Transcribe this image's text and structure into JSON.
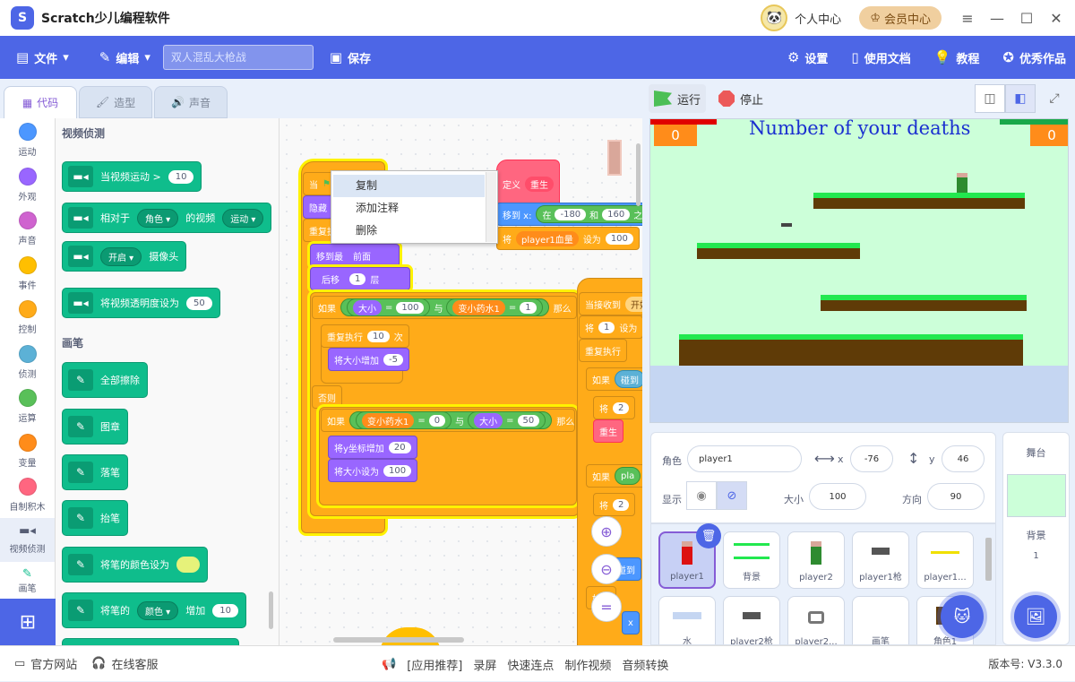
{
  "titlebar": {
    "app_title": "Scratch少儿编程软件",
    "personal_center": "个人中心",
    "vip_label": "会员中心",
    "window_controls": [
      "≡",
      "—",
      "☐",
      "✕"
    ]
  },
  "menubar": {
    "file": "文件",
    "edit": "编辑",
    "project_placeholder": "双人混乱大枪战",
    "save": "保存",
    "settings": "设置",
    "docs": "使用文档",
    "tutorial": "教程",
    "showcase": "优秀作品"
  },
  "tabs": {
    "code": "代码",
    "costume": "造型",
    "sound": "声音"
  },
  "categories": [
    {
      "label": "运动",
      "color": "#4c97ff"
    },
    {
      "label": "外观",
      "color": "#9966ff"
    },
    {
      "label": "声音",
      "color": "#cf63cf"
    },
    {
      "label": "事件",
      "color": "#ffbf00"
    },
    {
      "label": "控制",
      "color": "#ffab19"
    },
    {
      "label": "侦测",
      "color": "#5cb1d6"
    },
    {
      "label": "运算",
      "color": "#59c059"
    },
    {
      "label": "变量",
      "color": "#ff8c1a"
    },
    {
      "label": "自制积木",
      "color": "#ff6680"
    },
    {
      "label": "视频侦测",
      "color": "#0fbd8c"
    },
    {
      "label": "画笔",
      "color": "#0fbd8c"
    }
  ],
  "palette": {
    "video_title": "视频侦测",
    "video_motion": "当视频运动 >",
    "video_motion_val": "10",
    "relative_to": "相对于",
    "relative_dd": "角色",
    "video_of": "的视频",
    "video_of_dd": "运动",
    "camera_dd": "开启",
    "camera": "摄像头",
    "transparency": "将视频透明度设为",
    "transparency_val": "50",
    "pen_title": "画笔",
    "clear": "全部擦除",
    "stamp": "图章",
    "pen_down": "落笔",
    "pen_up": "抬笔",
    "pen_color": "将笔的颜色设为",
    "pen_change": "将笔的",
    "pen_change_dd": "颜色",
    "pen_change_by": "增加",
    "pen_change_val": "10"
  },
  "context_menu": {
    "copy": "复制",
    "add_comment": "添加注释",
    "delete": "删除"
  },
  "code": {
    "when": "当",
    "hide": "隐藏",
    "repeat_forever": "重复执行",
    "go_to_layer": "移到最",
    "layer_dd": "前面",
    "go_back": "后移",
    "back_val": "1",
    "layer": "层",
    "if": "如果",
    "then": "那么",
    "size": "大小",
    "eq": "=",
    "size_val": "100",
    "and": "与",
    "shrink_var": "变小药水1",
    "shrink_val": "1",
    "repeat": "重复执行",
    "repeat_n": "10",
    "times": "次",
    "size_change": "将大小增加",
    "size_change_val": "-5",
    "else": "否则",
    "zero": "0",
    "size_val2": "50",
    "y_change": "将y坐标增加",
    "y_change_val": "20",
    "size_set": "将大小设为",
    "size_set_val": "100",
    "define": "定义",
    "reborn": "重生",
    "move_to": "移到 x:",
    "in": "在",
    "x_min": "-180",
    "and2": "和",
    "x_max": "160",
    "between": "之间",
    "set": "将",
    "hp_var": "player1血量",
    "set_to": "设为",
    "hp_val": "100",
    "when_receive": "当接收到",
    "receive_dd": "开始",
    "set2": "将",
    "one": "1",
    "turn": "设为",
    "forever2": "重复执行",
    "touch": "碰到",
    "two": "2",
    "reborn2": "重生",
    "pla": "pla",
    "arrive": "碰到",
    "x": "x"
  },
  "stage": {
    "run": "运行",
    "stop": "停止",
    "title": "Number of your deaths",
    "score_left": "0",
    "score_right": "0"
  },
  "sprite_info": {
    "role_label": "角色",
    "name": "player1",
    "x_label": "x",
    "x": "-76",
    "y_label": "y",
    "y": "46",
    "show_label": "显示",
    "size_label": "大小",
    "size": "100",
    "dir_label": "方向",
    "direction": "90"
  },
  "sprites": [
    "player1",
    "背景",
    "player2",
    "player1枪",
    "player1...",
    "水",
    "player2枪",
    "player2...",
    "画笔",
    "角色1"
  ],
  "stage_panel": {
    "title": "舞台",
    "bg_label": "背景",
    "bg_count": "1"
  },
  "statusbar": {
    "website": "官方网站",
    "service": "在线客服",
    "apps": "[应用推荐]",
    "record": "录屏",
    "quick": "快速连点",
    "video": "制作视频",
    "audio": "音频转换",
    "version": "版本号: V3.3.0"
  },
  "colors": {
    "brand": "#4d66e6",
    "stage_bg": "#ccffd9",
    "platform": "#5f3b07",
    "grass": "#22e84f"
  }
}
